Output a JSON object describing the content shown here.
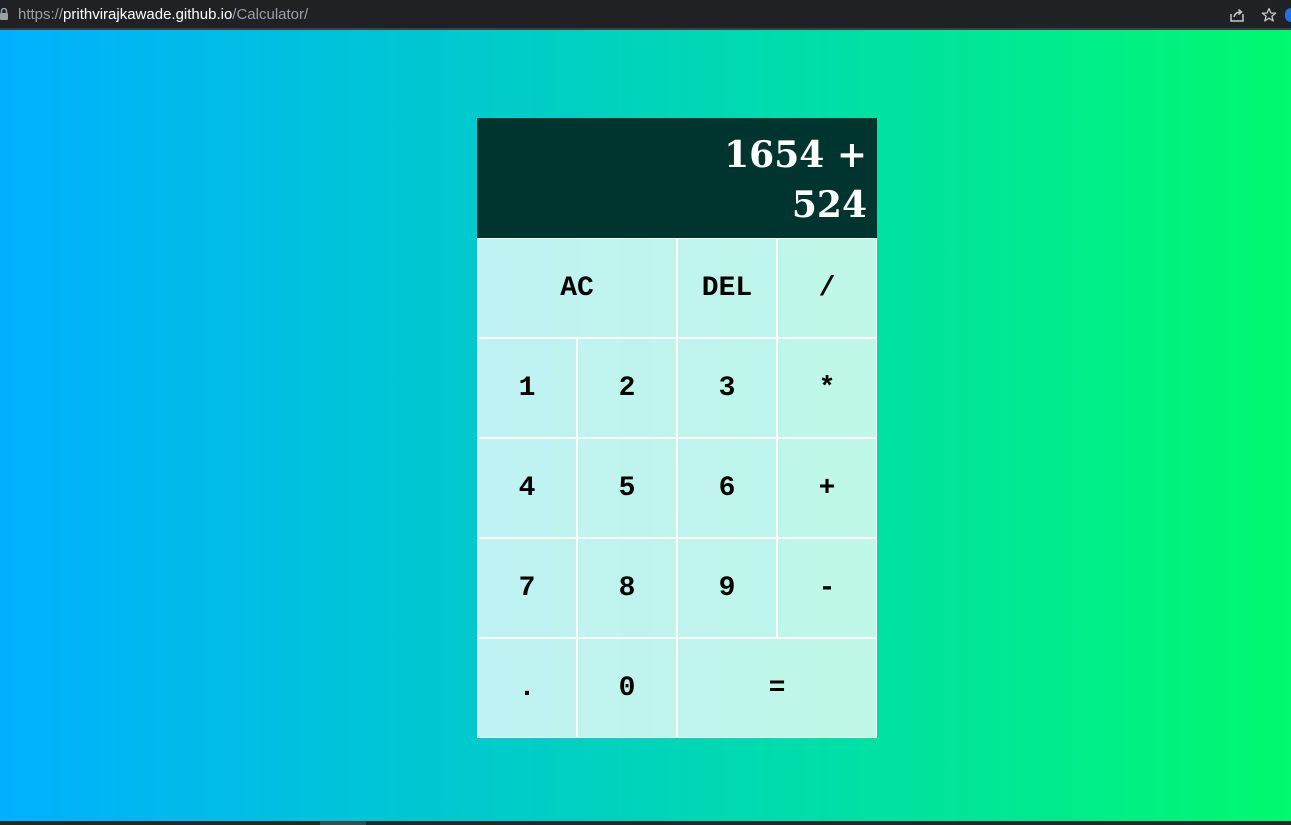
{
  "browser": {
    "url_prefix": "https://",
    "url_domain": "prithvirajkawade.github.io",
    "url_path": "/Calculator/"
  },
  "calculator": {
    "display": "1654 + 524",
    "keys": {
      "ac": "AC",
      "del": "DEL",
      "divide": "/",
      "one": "1",
      "two": "2",
      "three": "3",
      "multiply": "*",
      "four": "4",
      "five": "5",
      "six": "6",
      "plus": "+",
      "seven": "7",
      "eight": "8",
      "nine": "9",
      "minus": "-",
      "dot": ".",
      "zero": "0",
      "equals": "="
    }
  },
  "colors": {
    "display_bg": "#00342e",
    "gradient_start": "#00b0ff",
    "gradient_end": "#00f96e"
  },
  "icons": [
    "lock-icon",
    "share-icon",
    "star-icon",
    "profile-icon"
  ]
}
